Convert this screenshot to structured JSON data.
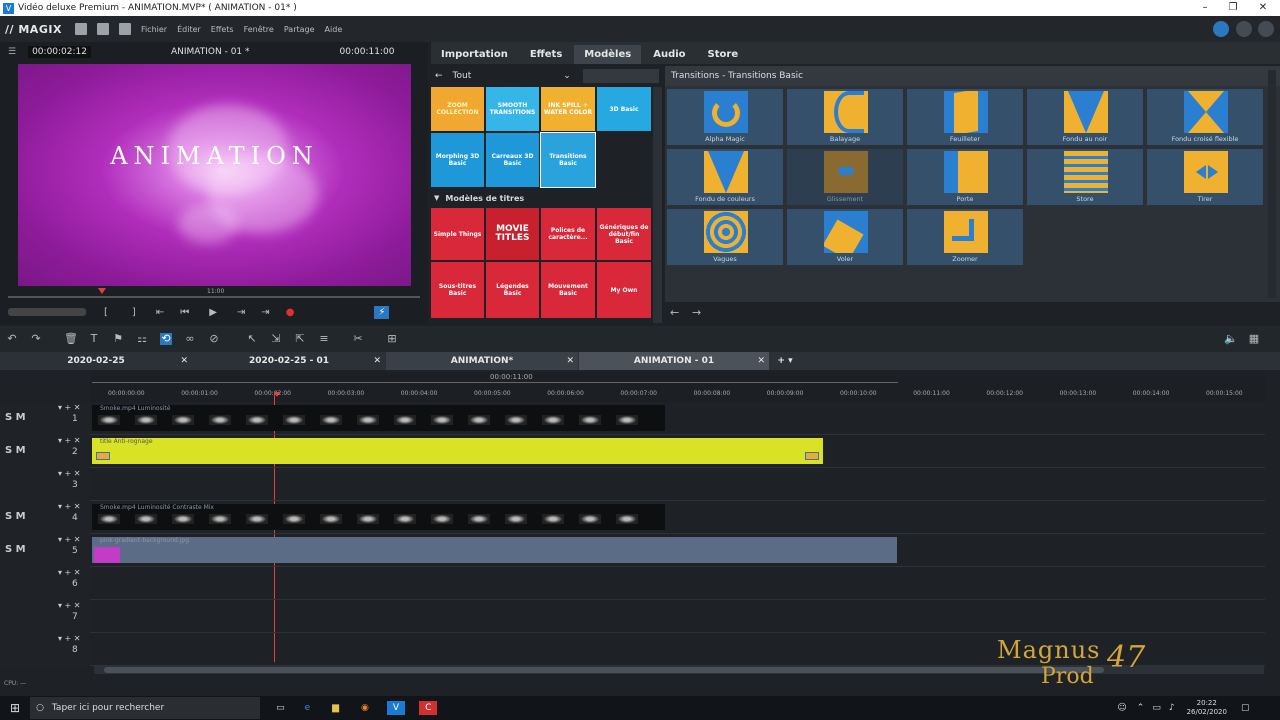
{
  "window": {
    "title": "Vidéo deluxe Premium - ANIMATION.MVP* ( ANIMATION - 01* )"
  },
  "menubar": {
    "logo": "// MAGIX",
    "items": [
      "Fichier",
      "Éditer",
      "Effets",
      "Fenêtre",
      "Partage",
      "Aide"
    ]
  },
  "preview": {
    "timecode_left": "00:00:02:12",
    "title": "ANIMATION - 01 *",
    "timecode_right": "00:00:11:00",
    "video_text": "ANIMATION",
    "scrub_time": "11:00"
  },
  "media_tabs": [
    "Importation",
    "Effets",
    "Modèles",
    "Audio",
    "Store"
  ],
  "active_tab": "Modèles",
  "templates": {
    "filter": "Tout",
    "tiles_top": [
      "ZOOM COLLECTION",
      "SMOOTH TRANSITIONS",
      "INK SPILL + WATER COLOR",
      "3D Basic",
      "Morphing 3D Basic",
      "Carreaux 3D Basic",
      "Transitions Basic"
    ],
    "section": "Modèles de titres",
    "tiles_titles": [
      "Simple Things",
      "MOVIE TITLES",
      "Polices de caractère...",
      "Génériques de début/fin Basic",
      "Sous-titres Basic",
      "Légendes Basic",
      "Mouvement Basic",
      "My Own"
    ]
  },
  "transitions": {
    "heading": "Transitions - Transitions Basic",
    "items": [
      "Alpha Magic",
      "Balayage",
      "Feuilleter",
      "Fondu au noir",
      "Fondu croisé flexible",
      "Fondu de couleurs",
      "Glissement",
      "Porte",
      "Store",
      "Tirer",
      "Vagues",
      "Voler",
      "Zoomer"
    ]
  },
  "project_tabs": [
    "2020-02-25",
    "2020-02-25 - 01",
    "ANIMATION*",
    "ANIMATION - 01"
  ],
  "timeline": {
    "duration": "00:00:11:00",
    "ruler_ticks": [
      "00:00:00:00",
      "00:00:01:00",
      "00:00:02:00",
      "00:00:03:00",
      "00:00:04:00",
      "00:00:05:00",
      "00:00:06:00",
      "00:00:07:00",
      "00:00:08:00",
      "00:00:09:00",
      "00:00:10:00",
      "00:00:11:00",
      "00:00:12:00",
      "00:00:13:00",
      "00:00:14:00",
      "00:00:15:00"
    ],
    "tracks": [
      {
        "num": "1",
        "clip": "Smoke.mp4   Luminosité"
      },
      {
        "num": "2",
        "clip": "title   Anti-rognage"
      },
      {
        "num": "3",
        "clip": ""
      },
      {
        "num": "4",
        "clip": "Smoke.mp4   Luminosité   Contraste Mix"
      },
      {
        "num": "5",
        "clip": "pink-gradient-background.jpg"
      },
      {
        "num": "6",
        "clip": ""
      },
      {
        "num": "7",
        "clip": ""
      },
      {
        "num": "8",
        "clip": ""
      }
    ],
    "track_controls": "S M"
  },
  "status": {
    "cpu": "CPU: —"
  },
  "watermark": {
    "line1": "Magnus",
    "line2": "Prod",
    "num": "47"
  },
  "taskbar": {
    "search": "Taper ici pour rechercher",
    "time": "20:22",
    "date": "26/02/2020"
  }
}
